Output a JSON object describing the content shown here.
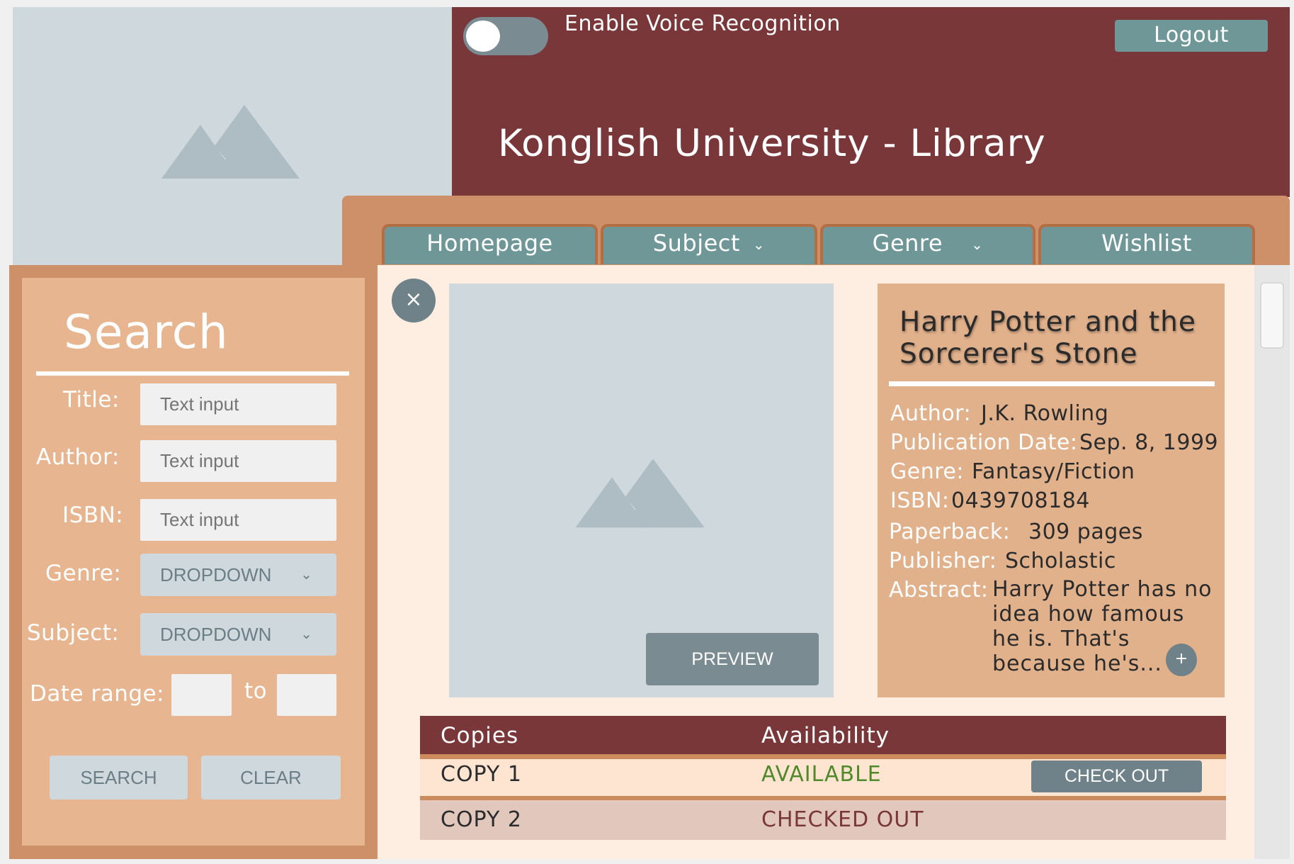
{
  "header": {
    "voice_toggle_label": "Enable Voice Recognition",
    "voice_enabled": false,
    "logout_label": "Logout",
    "site_title": "Konglish University - Library"
  },
  "nav": {
    "tabs": [
      {
        "label": "Homepage",
        "has_dropdown": false
      },
      {
        "label": "Subject",
        "has_dropdown": true
      },
      {
        "label": "Genre",
        "has_dropdown": true
      },
      {
        "label": "Wishlist",
        "has_dropdown": false
      }
    ]
  },
  "search": {
    "title": "Search",
    "fields": {
      "title_label": "Title:",
      "title_placeholder": "Text input",
      "author_label": "Author:",
      "author_placeholder": "Text input",
      "isbn_label": "ISBN:",
      "isbn_placeholder": "Text input",
      "genre_label": "Genre:",
      "genre_value": "DROPDOWN",
      "subject_label": "Subject:",
      "subject_value": "DROPDOWN",
      "date_label": "Date range:",
      "date_to": "to"
    },
    "search_button": "SEARCH",
    "clear_button": "CLEAR"
  },
  "detail": {
    "close_icon": "×",
    "preview_button": "PREVIEW",
    "book_title": "Harry Potter and the Sorcerer's Stone",
    "author_label": "Author:",
    "author": "J.K. Rowling",
    "pubdate_label": "Publication Date:",
    "pubdate": "Sep. 8, 1999",
    "genre_label": "Genre:",
    "genre": "Fantasy/Fiction",
    "isbn_label": "ISBN:",
    "isbn": "0439708184",
    "format_label": "Paperback:",
    "pages": "309 pages",
    "publisher_label": "Publisher:",
    "publisher": "Scholastic",
    "abstract_label": "Abstract:",
    "abstract": "Harry Potter has no idea how famous he is. That's because he's...",
    "expand_icon": "+"
  },
  "copies": {
    "col_copies": "Copies",
    "col_availability": "Availability",
    "rows": [
      {
        "copy": "COPY 1",
        "status": "AVAILABLE",
        "status_color": "#4f8a2a",
        "action": "CHECK OUT"
      },
      {
        "copy": "COPY 2",
        "status": "CHECKED OUT",
        "status_color": "#7a373a"
      }
    ]
  },
  "colors": {
    "header": "#7a373a",
    "nav": "#cd9068",
    "tab": "#6f9797",
    "panel": "#e7b690",
    "main": "#fdeee1"
  }
}
